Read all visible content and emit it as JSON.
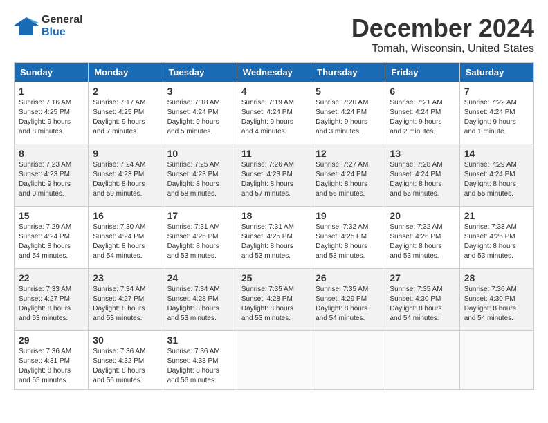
{
  "logo": {
    "line1": "General",
    "line2": "Blue"
  },
  "title": "December 2024",
  "subtitle": "Tomah, Wisconsin, United States",
  "weekdays": [
    "Sunday",
    "Monday",
    "Tuesday",
    "Wednesday",
    "Thursday",
    "Friday",
    "Saturday"
  ],
  "weeks": [
    [
      {
        "day": "1",
        "info": "Sunrise: 7:16 AM\nSunset: 4:25 PM\nDaylight: 9 hours\nand 8 minutes."
      },
      {
        "day": "2",
        "info": "Sunrise: 7:17 AM\nSunset: 4:25 PM\nDaylight: 9 hours\nand 7 minutes."
      },
      {
        "day": "3",
        "info": "Sunrise: 7:18 AM\nSunset: 4:24 PM\nDaylight: 9 hours\nand 5 minutes."
      },
      {
        "day": "4",
        "info": "Sunrise: 7:19 AM\nSunset: 4:24 PM\nDaylight: 9 hours\nand 4 minutes."
      },
      {
        "day": "5",
        "info": "Sunrise: 7:20 AM\nSunset: 4:24 PM\nDaylight: 9 hours\nand 3 minutes."
      },
      {
        "day": "6",
        "info": "Sunrise: 7:21 AM\nSunset: 4:24 PM\nDaylight: 9 hours\nand 2 minutes."
      },
      {
        "day": "7",
        "info": "Sunrise: 7:22 AM\nSunset: 4:24 PM\nDaylight: 9 hours\nand 1 minute."
      }
    ],
    [
      {
        "day": "8",
        "info": "Sunrise: 7:23 AM\nSunset: 4:23 PM\nDaylight: 9 hours\nand 0 minutes."
      },
      {
        "day": "9",
        "info": "Sunrise: 7:24 AM\nSunset: 4:23 PM\nDaylight: 8 hours\nand 59 minutes."
      },
      {
        "day": "10",
        "info": "Sunrise: 7:25 AM\nSunset: 4:23 PM\nDaylight: 8 hours\nand 58 minutes."
      },
      {
        "day": "11",
        "info": "Sunrise: 7:26 AM\nSunset: 4:23 PM\nDaylight: 8 hours\nand 57 minutes."
      },
      {
        "day": "12",
        "info": "Sunrise: 7:27 AM\nSunset: 4:24 PM\nDaylight: 8 hours\nand 56 minutes."
      },
      {
        "day": "13",
        "info": "Sunrise: 7:28 AM\nSunset: 4:24 PM\nDaylight: 8 hours\nand 55 minutes."
      },
      {
        "day": "14",
        "info": "Sunrise: 7:29 AM\nSunset: 4:24 PM\nDaylight: 8 hours\nand 55 minutes."
      }
    ],
    [
      {
        "day": "15",
        "info": "Sunrise: 7:29 AM\nSunset: 4:24 PM\nDaylight: 8 hours\nand 54 minutes."
      },
      {
        "day": "16",
        "info": "Sunrise: 7:30 AM\nSunset: 4:24 PM\nDaylight: 8 hours\nand 54 minutes."
      },
      {
        "day": "17",
        "info": "Sunrise: 7:31 AM\nSunset: 4:25 PM\nDaylight: 8 hours\nand 53 minutes."
      },
      {
        "day": "18",
        "info": "Sunrise: 7:31 AM\nSunset: 4:25 PM\nDaylight: 8 hours\nand 53 minutes."
      },
      {
        "day": "19",
        "info": "Sunrise: 7:32 AM\nSunset: 4:25 PM\nDaylight: 8 hours\nand 53 minutes."
      },
      {
        "day": "20",
        "info": "Sunrise: 7:32 AM\nSunset: 4:26 PM\nDaylight: 8 hours\nand 53 minutes."
      },
      {
        "day": "21",
        "info": "Sunrise: 7:33 AM\nSunset: 4:26 PM\nDaylight: 8 hours\nand 53 minutes."
      }
    ],
    [
      {
        "day": "22",
        "info": "Sunrise: 7:33 AM\nSunset: 4:27 PM\nDaylight: 8 hours\nand 53 minutes."
      },
      {
        "day": "23",
        "info": "Sunrise: 7:34 AM\nSunset: 4:27 PM\nDaylight: 8 hours\nand 53 minutes."
      },
      {
        "day": "24",
        "info": "Sunrise: 7:34 AM\nSunset: 4:28 PM\nDaylight: 8 hours\nand 53 minutes."
      },
      {
        "day": "25",
        "info": "Sunrise: 7:35 AM\nSunset: 4:28 PM\nDaylight: 8 hours\nand 53 minutes."
      },
      {
        "day": "26",
        "info": "Sunrise: 7:35 AM\nSunset: 4:29 PM\nDaylight: 8 hours\nand 54 minutes."
      },
      {
        "day": "27",
        "info": "Sunrise: 7:35 AM\nSunset: 4:30 PM\nDaylight: 8 hours\nand 54 minutes."
      },
      {
        "day": "28",
        "info": "Sunrise: 7:36 AM\nSunset: 4:30 PM\nDaylight: 8 hours\nand 54 minutes."
      }
    ],
    [
      {
        "day": "29",
        "info": "Sunrise: 7:36 AM\nSunset: 4:31 PM\nDaylight: 8 hours\nand 55 minutes."
      },
      {
        "day": "30",
        "info": "Sunrise: 7:36 AM\nSunset: 4:32 PM\nDaylight: 8 hours\nand 56 minutes."
      },
      {
        "day": "31",
        "info": "Sunrise: 7:36 AM\nSunset: 4:33 PM\nDaylight: 8 hours\nand 56 minutes."
      },
      {
        "day": "",
        "info": ""
      },
      {
        "day": "",
        "info": ""
      },
      {
        "day": "",
        "info": ""
      },
      {
        "day": "",
        "info": ""
      }
    ]
  ]
}
